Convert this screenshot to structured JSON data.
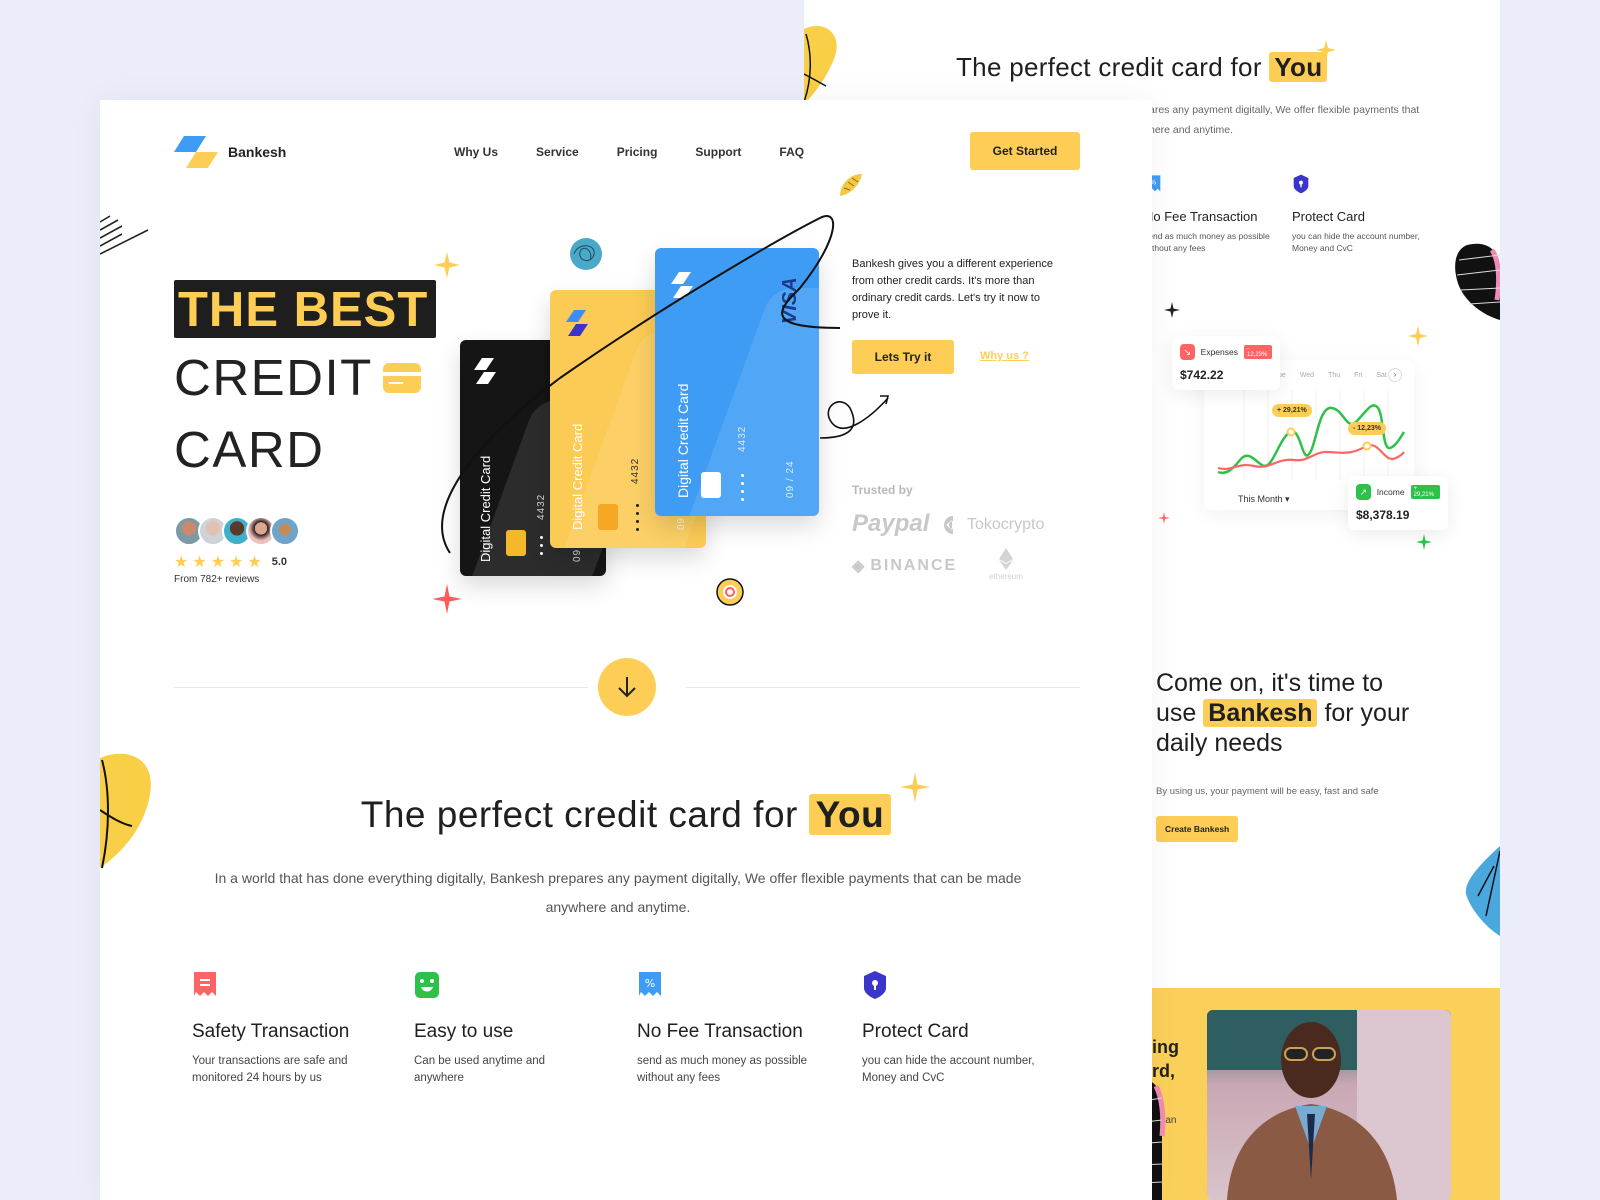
{
  "brand": {
    "name": "Bankesh",
    "accent": "#fdcd55",
    "dark": "#1e1e1e",
    "blue": "#3f9cf5"
  },
  "nav": {
    "links": [
      "Why Us",
      "Service",
      "Pricing",
      "Support",
      "FAQ"
    ],
    "cta": "Get Started"
  },
  "hero": {
    "highlight": "THE BEST",
    "line2": "CREDIT",
    "line3": "CARD",
    "rating": "5.0",
    "stars": 5,
    "reviews": "From 782+ reviews",
    "description": "Bankesh gives you a different experience from other credit cards. It's more than ordinary credit cards. Let's try it now to prove it.",
    "primary_button": "Lets Try it",
    "secondary_link": "Why us ?",
    "trusted_label": "Trusted by",
    "trusted_logos": [
      "Paypal",
      "Tokocrypto",
      "BINANCE",
      "ethereum"
    ],
    "cards": [
      {
        "name": "Digital Credit Card",
        "number": "4432",
        "expiry": "09",
        "color": "#151515"
      },
      {
        "name": "Digital Credit Card",
        "number": "4432",
        "expiry": "09",
        "color": "#fccb55"
      },
      {
        "name": "Digital Credit Card",
        "number": "4432",
        "expiry": "09 / 24",
        "network": "VISA",
        "color": "#3f9cf5"
      }
    ]
  },
  "features_section": {
    "title_prefix": "The perfect credit card for",
    "title_highlight": "You",
    "description": "In a world that has done everything digitally, Bankesh prepares any payment digitally, We offer flexible payments that can be made anywhere and anytime.",
    "features": [
      {
        "icon": "receipt-icon",
        "color": "#ff6464",
        "title": "Safety Transaction",
        "text": "Your transactions are safe and monitored 24 hours by us"
      },
      {
        "icon": "smile-icon",
        "color": "#2ec14a",
        "title": "Easy to use",
        "text": "Can be used anytime and anywhere"
      },
      {
        "icon": "discount-receipt-icon",
        "color": "#3f9cf5",
        "title": "No Fee Transaction",
        "text": "send as much money as possible without any fees"
      },
      {
        "icon": "shield-lock-icon",
        "color": "#3b35c9",
        "title": "Protect Card",
        "text": "you can hide the account number, Money and CvC"
      }
    ]
  },
  "back_page": {
    "title_prefix": "The perfect credit card for",
    "title_highlight": "You",
    "intro_line1": "ares any payment digitally, We offer flexible payments that",
    "intro_line2": "here and anytime.",
    "features": [
      {
        "title": "No Fee Transaction",
        "text": "send as much money as possible without any fees"
      },
      {
        "title": "Protect Card",
        "text": "you can hide the account number, Money and CvC"
      }
    ],
    "dashboard": {
      "days": [
        "Tue",
        "Wed",
        "Thu",
        "Fri",
        "Sat"
      ],
      "period": "This Month",
      "pill_up": "+ 29,21%",
      "pill_down": "- 12,23%",
      "expenses": {
        "label": "Expenses",
        "badge": "- 12,23%",
        "value": "$742.22",
        "color": "#ff6464"
      },
      "income": {
        "label": "Income",
        "badge": "+ 29,21%",
        "value": "$8,378.19",
        "color": "#2ec14a"
      }
    },
    "cta": {
      "line1": "Come on, it's time to",
      "pre": "use",
      "highlight": "Bankesh",
      "post": "for your",
      "line3": "daily needs",
      "subtitle": "By using us, your payment will be easy, fast and safe",
      "button": "Create Bankesh"
    },
    "yellow_band": {
      "line1": "ing",
      "line2": "rd,",
      "line3": "u can"
    }
  }
}
